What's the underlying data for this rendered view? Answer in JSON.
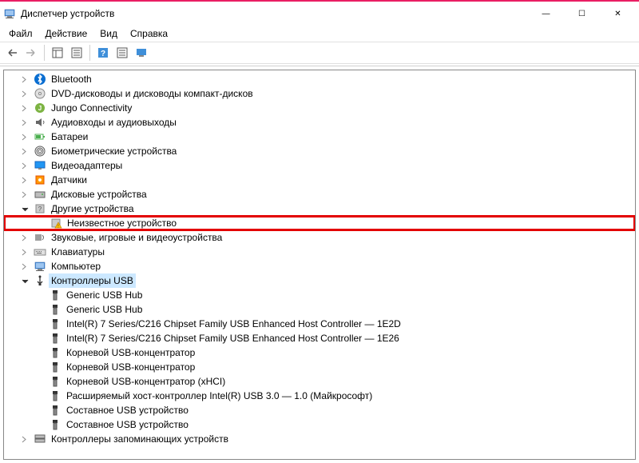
{
  "window": {
    "title": "Диспетчер устройств"
  },
  "menu": {
    "file": "Файл",
    "action": "Действие",
    "view": "Вид",
    "help": "Справка"
  },
  "tree": {
    "bluetooth": "Bluetooth",
    "dvd": "DVD-дисководы и дисководы компакт-дисков",
    "jungo": "Jungo Connectivity",
    "audio_io": "Аудиовходы и аудиовыходы",
    "batteries": "Батареи",
    "biometric": "Биометрические устройства",
    "video_adapters": "Видеоадаптеры",
    "sensors": "Датчики",
    "disk_devices": "Дисковые устройства",
    "other_devices": "Другие устройства",
    "unknown_device": "Неизвестное устройство",
    "sound_video_game": "Звуковые, игровые и видеоустройства",
    "keyboards": "Клавиатуры",
    "computer": "Компьютер",
    "usb_controllers": "Контроллеры USB",
    "usb1": "Generic USB Hub",
    "usb2": "Generic USB Hub",
    "usb3": "Intel(R) 7 Series/C216 Chipset Family USB Enhanced Host Controller — 1E2D",
    "usb4": "Intel(R) 7 Series/C216 Chipset Family USB Enhanced Host Controller — 1E26",
    "usb5": "Корневой USB-концентратор",
    "usb6": "Корневой USB-концентратор",
    "usb7": "Корневой USB-концентратор (xHCI)",
    "usb8": "Расширяемый хост-контроллер Intel(R) USB 3.0 — 1.0 (Майкрософт)",
    "usb9": "Составное USB устройство",
    "usb10": "Составное USB устройство",
    "storage_controllers": "Контроллеры запоминающих устройств"
  }
}
